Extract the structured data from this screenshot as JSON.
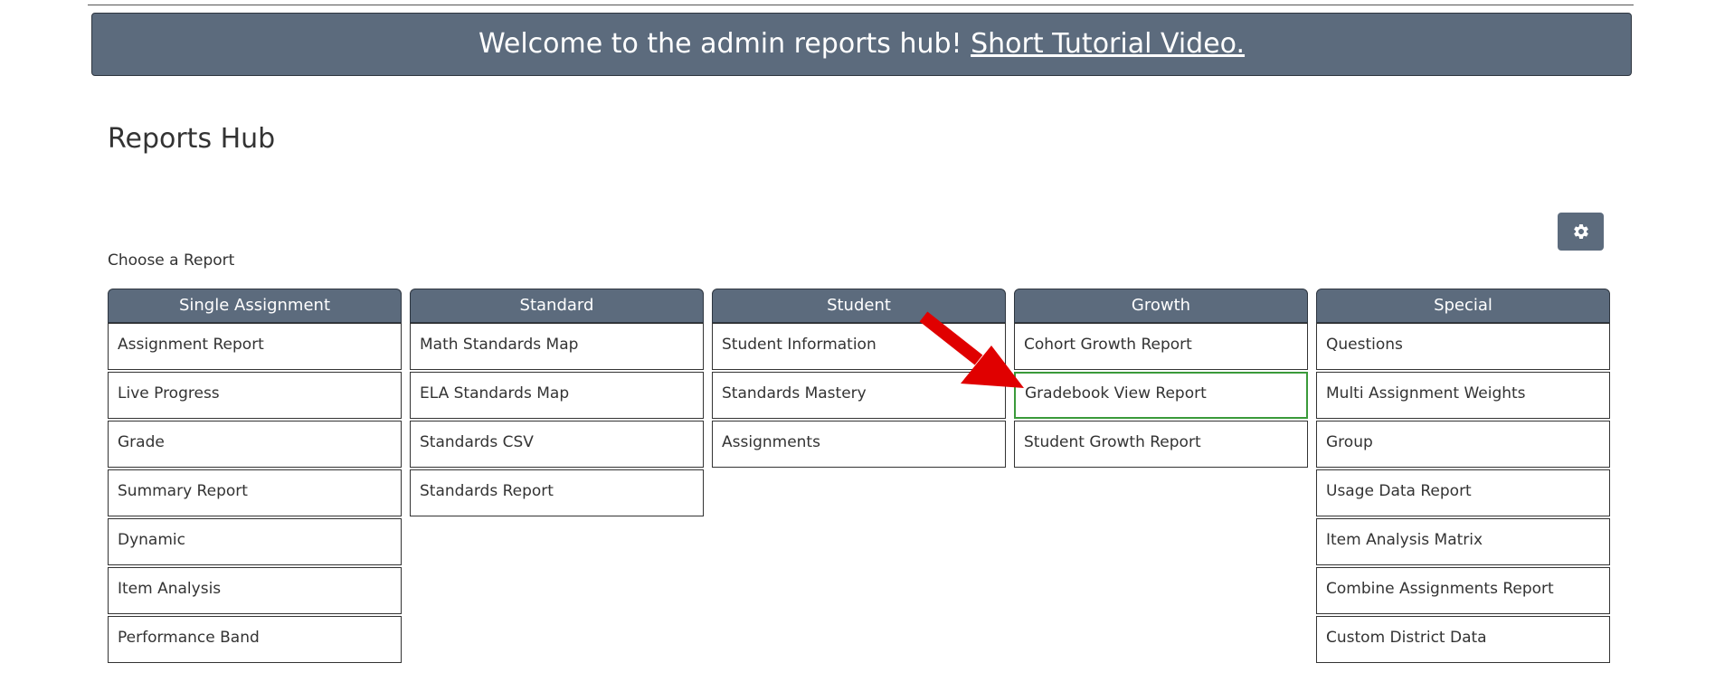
{
  "banner": {
    "welcome_text": "Welcome to the admin reports hub! ",
    "tutorial_link": "Short Tutorial Video."
  },
  "page": {
    "title": "Reports Hub",
    "choose_label": "Choose a Report"
  },
  "icons": {
    "settings": "gear-icon",
    "annotation": "red-arrow"
  },
  "colors": {
    "header_bg": "#5c6b7d",
    "highlight_border": "#3a9a3a",
    "arrow": "#e00000"
  },
  "columns": [
    {
      "title": "Single Assignment",
      "items": [
        "Assignment Report",
        "Live Progress",
        "Grade",
        "Summary Report",
        "Dynamic",
        "Item Analysis",
        "Performance Band"
      ]
    },
    {
      "title": "Standard",
      "items": [
        "Math Standards Map",
        "ELA Standards Map",
        "Standards CSV",
        "Standards Report"
      ]
    },
    {
      "title": "Student",
      "items": [
        "Student Information",
        "Standards Mastery",
        "Assignments"
      ]
    },
    {
      "title": "Growth",
      "items": [
        "Cohort Growth Report",
        "Gradebook View Report",
        "Student Growth Report"
      ]
    },
    {
      "title": "Special",
      "items": [
        "Questions",
        "Multi Assignment Weights",
        "Group",
        "Usage Data Report",
        "Item Analysis Matrix",
        "Combine Assignments Report",
        "Custom District Data"
      ]
    }
  ]
}
